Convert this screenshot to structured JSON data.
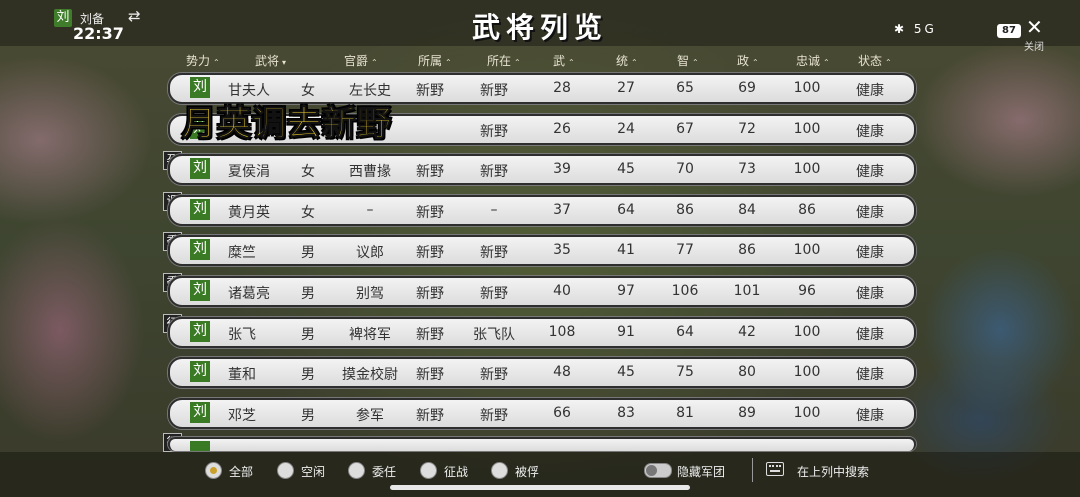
{
  "header": {
    "lord_flag": "刘",
    "lord_name": "刘备",
    "swap_icon": "⇄",
    "time": "22:37",
    "title": "武将列览",
    "status_icons": "✱ 5G",
    "battery": "87",
    "close_icon": "✕",
    "close_label": "关闭"
  },
  "columns": [
    "势力",
    "武将",
    "官爵",
    "所属",
    "所在",
    "武",
    "统",
    "智",
    "政",
    "忠诚",
    "状态"
  ],
  "rows": [
    {
      "tag": "",
      "faction": "刘",
      "name": "甘夫人",
      "gender": "女",
      "rank": "左长史",
      "belong": "新野",
      "location": "新野",
      "wu": "28",
      "tong": "27",
      "zhi": "65",
      "zheng": "69",
      "loyalty": "100",
      "state": "健康"
    },
    {
      "tag": "",
      "faction": "刘",
      "name": "",
      "gender": "",
      "rank": "",
      "belong": "",
      "location": "新野",
      "wu": "26",
      "tong": "24",
      "zhi": "67",
      "zheng": "72",
      "loyalty": "100",
      "state": "健康"
    },
    {
      "tag": "孕",
      "faction": "刘",
      "name": "夏侯涓",
      "gender": "女",
      "rank": "西曹掾",
      "belong": "新野",
      "location": "新野",
      "wu": "39",
      "tong": "45",
      "zhi": "70",
      "zheng": "73",
      "loyalty": "100",
      "state": "健康"
    },
    {
      "tag": "调",
      "faction": "刘",
      "name": "黄月英",
      "gender": "女",
      "rank": "–",
      "belong": "新野",
      "location": "–",
      "wu": "37",
      "tong": "64",
      "zhi": "86",
      "zheng": "84",
      "loyalty": "86",
      "state": "健康"
    },
    {
      "tag": "委",
      "faction": "刘",
      "name": "糜竺",
      "gender": "男",
      "rank": "议郎",
      "belong": "新野",
      "location": "新野",
      "wu": "35",
      "tong": "41",
      "zhi": "77",
      "zheng": "86",
      "loyalty": "100",
      "state": "健康"
    },
    {
      "tag": "委",
      "faction": "刘",
      "name": "诸葛亮",
      "gender": "男",
      "rank": "别驾",
      "belong": "新野",
      "location": "新野",
      "wu": "40",
      "tong": "97",
      "zhi": "106",
      "zheng": "101",
      "loyalty": "96",
      "state": "健康"
    },
    {
      "tag": "征",
      "faction": "刘",
      "name": "张飞",
      "gender": "男",
      "rank": "裨将军",
      "belong": "新野",
      "location": "张飞队",
      "wu": "108",
      "tong": "91",
      "zhi": "64",
      "zheng": "42",
      "loyalty": "100",
      "state": "健康"
    },
    {
      "tag": "",
      "faction": "刘",
      "name": "董和",
      "gender": "男",
      "rank": "摸金校尉",
      "belong": "新野",
      "location": "新野",
      "wu": "48",
      "tong": "45",
      "zhi": "75",
      "zheng": "80",
      "loyalty": "100",
      "state": "健康"
    },
    {
      "tag": "",
      "faction": "刘",
      "name": "邓芝",
      "gender": "男",
      "rank": "参军",
      "belong": "新野",
      "location": "新野",
      "wu": "66",
      "tong": "83",
      "zhi": "81",
      "zheng": "89",
      "loyalty": "100",
      "state": "健康"
    }
  ],
  "partial_row_tag": "征",
  "banner": "月英调去新野",
  "filters": [
    {
      "label": "全部",
      "selected": true
    },
    {
      "label": "空闲",
      "selected": false
    },
    {
      "label": "委任",
      "selected": false
    },
    {
      "label": "征战",
      "selected": false
    },
    {
      "label": "被俘",
      "selected": false
    }
  ],
  "hide_army_label": "隐藏军团",
  "search_label": "在上列中搜索"
}
